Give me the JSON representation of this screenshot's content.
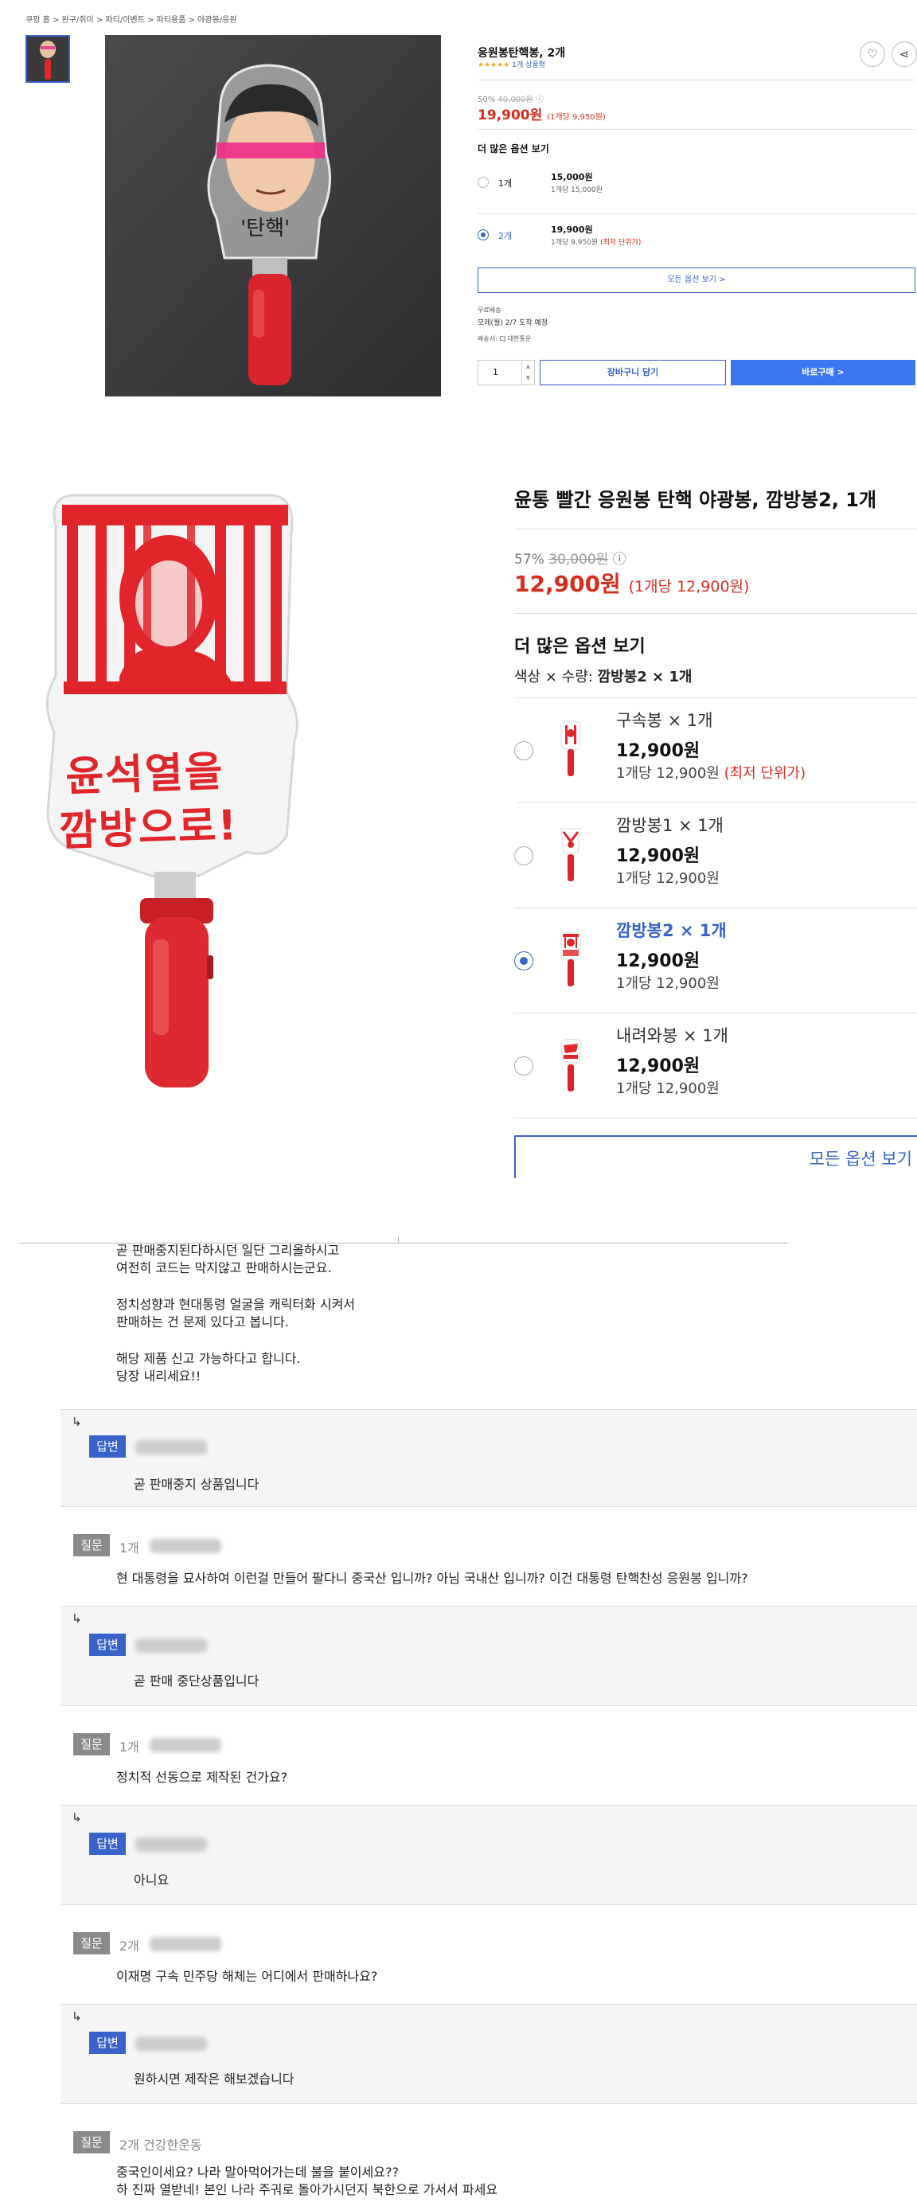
{
  "compact": {
    "breadcrumb": "쿠팡 홈 > 완구/취미 > 파티/이벤트 > 파티용품 > 야광봉/응원",
    "title": "응원봉탄핵봉, 2개",
    "stars": "★★★★★",
    "review_count": "1개 상품평",
    "discount": "50%",
    "original_price": "40,000원",
    "price": "19,900원",
    "unit_price": "(1개당 9,950원)",
    "sign_text": "'탄핵'",
    "options_heading": "더 많은 옵션 보기",
    "options": [
      {
        "name": "1개",
        "price": "15,000원",
        "unit": "1개당 15,000원",
        "tag": "",
        "selected": false
      },
      {
        "name": "2개",
        "price": "19,900원",
        "unit": "1개당 9,950원",
        "tag": "(최저 단위가)",
        "selected": true
      }
    ],
    "all_options": "모든 옵션 보기 >",
    "shipping_label": "무료배송",
    "shipping_date": "모레(월) 2/7 도착 예정",
    "seller": "배송사: CJ 대한통운",
    "qty": "1",
    "cart_button": "장바구니 담기",
    "buy_button": "바로구매 >"
  },
  "detail": {
    "title": "윤통 빨간 응원봉 탄핵 야광봉, 깜방봉2, 1개",
    "discount": "57%",
    "original_price": "30,000원",
    "price": "12,900원",
    "unit_price": "(1개당 12,900원)",
    "sign_text_1": "윤석열을",
    "sign_text_2": "깜방으로!",
    "options_heading": "더 많은 옵션 보기",
    "option_selector_label": "색상 × 수량:",
    "option_selector_value": "깜방봉2 × 1개",
    "options": [
      {
        "name": "구속봉 × 1개",
        "price": "12,900원",
        "unit": "1개당 12,900원",
        "tag": "(최저 단위가)",
        "selected": false
      },
      {
        "name": "깜방봉1 × 1개",
        "price": "12,900원",
        "unit": "1개당 12,900원",
        "tag": "",
        "selected": false
      },
      {
        "name": "깜방봉2 × 1개",
        "price": "12,900원",
        "unit": "1개당 12,900원",
        "tag": "",
        "selected": true
      },
      {
        "name": "내려와봉 × 1개",
        "price": "12,900원",
        "unit": "1개당 12,900원",
        "tag": "",
        "selected": false
      }
    ],
    "all_options": "모든 옵션 보기"
  },
  "qa": {
    "top_fragment": [
      "곧 판매중지된다하시던 일단 그리올하시고",
      "여전히 코드는 막지않고 판매하시는군요.",
      "",
      "정치성향과 현대통령 얼굴을 캐릭터화 시켜서",
      "판매하는 건 문제 있다고 봅니다.",
      "",
      "해당 제품 신고 가능하다고 합니다.",
      "당장 내리세요!!"
    ],
    "question_badge": "질문",
    "answer_badge": "답변",
    "items": [
      {
        "type": "answer",
        "meta": "",
        "text": [
          "곧 판매중지 상품입니다"
        ]
      },
      {
        "type": "question",
        "meta": "1개",
        "text": [
          "현 대통령을 묘사하여 이런걸 만들어 팔다니 중국산 입니까? 아님 국내산 입니까? 이건 대통령 탄핵찬성 응원봉 입니까?"
        ]
      },
      {
        "type": "answer",
        "meta": "",
        "text": [
          "곧 판매 중단상품입니다"
        ]
      },
      {
        "type": "question",
        "meta": "1개",
        "text": [
          "정치적 선동으로 제작된 건가요?"
        ]
      },
      {
        "type": "answer",
        "meta": "",
        "text": [
          "아니요"
        ]
      },
      {
        "type": "question",
        "meta": "2개",
        "text": [
          "이재명 구속 민주당 해체는 어디에서 판매하나요?"
        ]
      },
      {
        "type": "answer",
        "meta": "",
        "text": [
          "원하시면 제작은 해보겠습니다"
        ]
      },
      {
        "type": "question",
        "meta": "2개   건강한운동",
        "text": [
          "중국인이세요? 나라 말아먹어가는데 불을 붙이세요??",
          "하 진짜 열받네! 본인 나라 주궈로 돌아가시던지 북한으로 가서서 파세요"
        ]
      }
    ]
  },
  "colors": {
    "accent": "#3a63c9",
    "price_red": "#d32f1f",
    "buy_blue": "#3a76f0",
    "stick_red": "#e0262b"
  }
}
